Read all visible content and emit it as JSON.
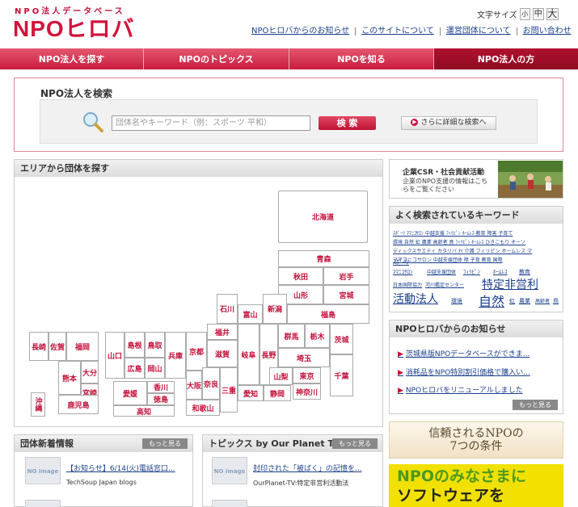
{
  "header": {
    "logo_sub": "NPO法人データベース",
    "logo": "NPOヒロバ",
    "font_size_label": "文字サイズ",
    "font_sizes": [
      "小",
      "中",
      "大"
    ],
    "links": [
      "NPOヒロバからのお知らせ",
      "このサイトについて",
      "運営団体について",
      "お問い合わせ"
    ]
  },
  "nav": {
    "items": [
      "NPO法人を探す",
      "NPOのトピックス",
      "NPOを知る",
      "NPO法人の方"
    ]
  },
  "search": {
    "title": "NPO法人を検索",
    "placeholder": "団体名やキーワード（例：スポーツ 平和）",
    "button": "検 索",
    "advanced": "さらに詳細な検索へ"
  },
  "area": {
    "title": "エリアから団体を探す",
    "prefectures": {
      "hokkaido": "北海道",
      "aomori": "青森",
      "akita": "秋田",
      "iwate": "岩手",
      "yamagata": "山形",
      "miyagi": "宮城",
      "fukushima": "福島",
      "ishikawa": "石川",
      "toyama": "富山",
      "niigata": "新潟",
      "fukui": "福井",
      "gunma": "群馬",
      "tochigi": "栃木",
      "ibaraki": "茨城",
      "gifu": "岐阜",
      "nagano": "長野",
      "saitama": "埼玉",
      "shiga": "滋賀",
      "kyoto": "京都",
      "hyogo": "兵庫",
      "osaka": "大阪",
      "nara": "奈良",
      "mie": "三重",
      "wakayama": "和歌山",
      "aichi": "愛知",
      "shizuoka": "静岡",
      "yamanashi": "山梨",
      "tokyo": "東京",
      "kanagawa": "神奈川",
      "chiba": "千葉",
      "shimane": "島根",
      "tottori": "鳥取",
      "hiroshima": "広島",
      "okayama": "岡山",
      "yamaguchi": "山口",
      "ehime": "愛媛",
      "kagawa": "香川",
      "tokushima": "徳島",
      "kochi": "高知",
      "nagasaki": "長崎",
      "saga": "佐賀",
      "fukuoka": "福岡",
      "kumamoto": "熊本",
      "oita": "大分",
      "miyazaki": "宮崎",
      "kagoshima": "鹿児島",
      "okinawa": "沖縄"
    }
  },
  "news": {
    "title": "団体新着情報",
    "more": "もっと見る",
    "no_image": "NO Image",
    "item_title": "【お知らせ】6/14(火)電話窓口...",
    "item_source": "TechSoup Japan blogs"
  },
  "topics": {
    "title": "トピックス by Our Planet TV",
    "more": "もっと見る",
    "no_image": "NO Image",
    "item_title": "封印された「被ばく」の記憶を...",
    "item_source": "OurPlanet-TV:特定非営利活動法"
  },
  "csr": {
    "title": "企業CSR・社会貢献活動",
    "desc": "企業のNPO支援の情報はこちらをご覧ください"
  },
  "keywords": {
    "title": "よく検索されているキーワード",
    "items": [
      "ｽﾎﾟｰﾂ",
      "ﾏﾏﾆｺｻﾛﾝ",
      "中越支援団体",
      "河川鑑定センター",
      "ﾌｨﾘﾋﾟﾝ",
      "ﾎｰﾑﾚｽ",
      "教育",
      "障害",
      "子育て",
      "日本国際協力",
      "特定非営利",
      "活動法人",
      "環境",
      "自然",
      "虹",
      "農業",
      "高齢者",
      "鳥",
      "オーソ",
      "ディックスサエティ",
      "カタリバ",
      "ﾀｲ",
      "ひきこもり",
      "介護"
    ]
  },
  "notice": {
    "title": "NPOヒロバからのお知らせ",
    "items": [
      "茨城県版NPOデータベースができま...",
      "消耗品をNPO特別割引価格で購入い...",
      "NPOヒロバをリニューアルしました"
    ],
    "more": "もっと見る"
  },
  "banner1": {
    "line1": "信頼されるNPOの",
    "line2": "7つの条件"
  },
  "banner2": {
    "line1": "NPOのみなさまに",
    "line2": "ソフトウェアを"
  }
}
